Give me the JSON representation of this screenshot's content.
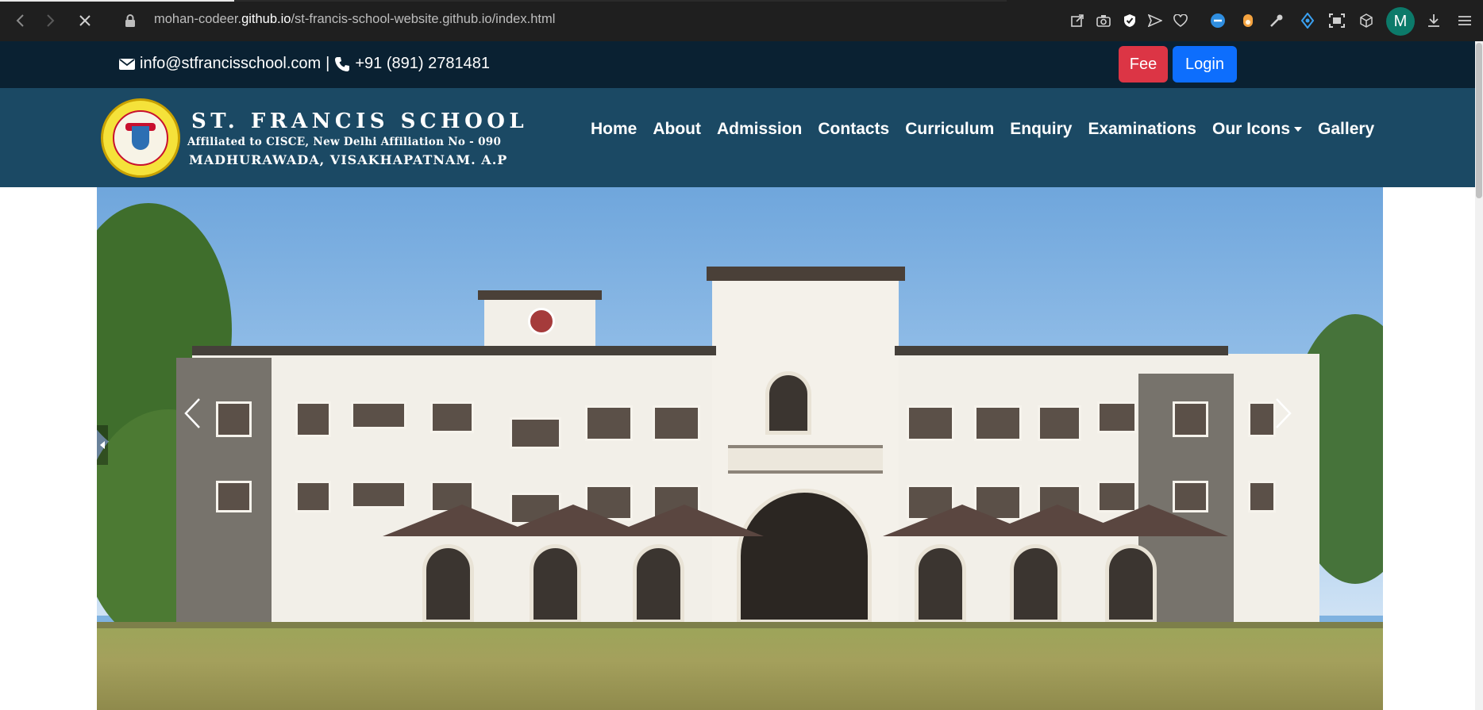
{
  "browser": {
    "url_prefix": "mohan-codeer.",
    "url_domain": "github.io",
    "url_path": "/st-francis-school-website.github.io/index.html",
    "profile_initial": "M",
    "icons": [
      "back-icon",
      "forward-icon",
      "stop-icon",
      "lock-icon",
      "share-icon",
      "camera-icon",
      "shield-icon",
      "send-icon",
      "heart-icon",
      "extension-icon",
      "extension-icon",
      "key-icon",
      "extension-icon",
      "screenshot-icon",
      "cube-icon",
      "download-icon",
      "menu-icon"
    ]
  },
  "topbar": {
    "email": "info@stfrancisschool.com",
    "separator": "|",
    "phone": "+91 (891) 2781481",
    "fee_label": "Fee",
    "login_label": "Login"
  },
  "brand": {
    "title": "ST. FRANCIS SCHOOL",
    "subtitle": "Affiliated to CISCE, New Delhi Affiliation No - 090",
    "location": "MADHURAWADA, VISAKHAPATNAM.  A.P"
  },
  "menu": {
    "home": "Home",
    "about": "About",
    "admission": "Admission",
    "contacts": "Contacts",
    "curriculum": "Curriculum",
    "enquiry": "Enquiry",
    "examinations": "Examinations",
    "our_icons": "Our Icons",
    "gallery": "Gallery"
  },
  "colors": {
    "topbar": "#0a2132",
    "navbar": "#1b4964",
    "fee": "#dc3545",
    "login": "#0d6efd"
  }
}
